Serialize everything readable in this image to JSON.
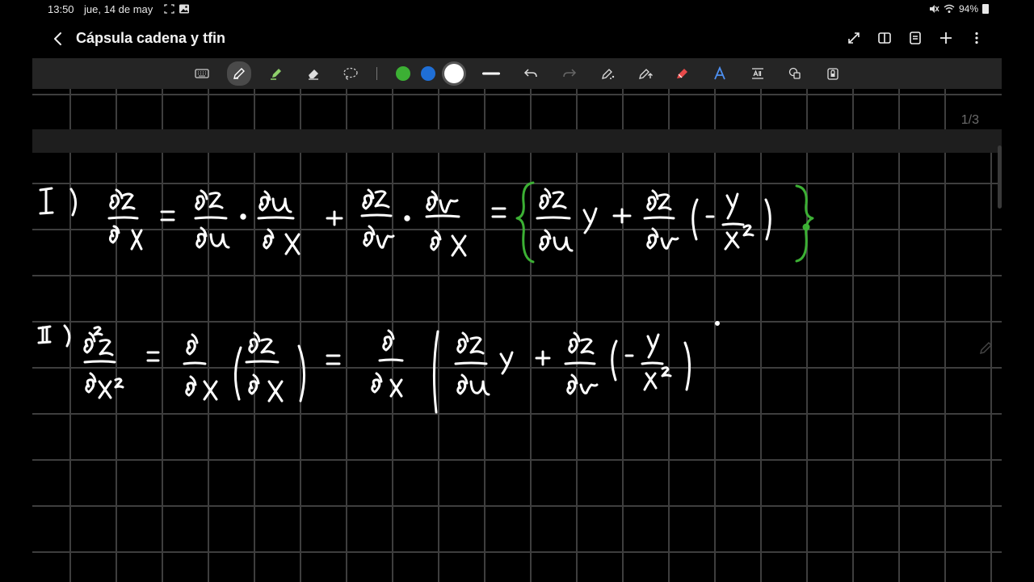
{
  "status": {
    "time": "13:50",
    "date": "jue, 14 de may",
    "battery": "94%"
  },
  "header": {
    "title": "Cápsula cadena y tfin"
  },
  "toolbar": {
    "tools": [
      "keyboard-icon",
      "pen-icon",
      "highlighter-icon",
      "eraser-icon",
      "lasso-icon"
    ],
    "colors": [
      "#3cb034",
      "#1f6fd6",
      "#ffffff"
    ],
    "actions": [
      "undo-icon",
      "redo-icon",
      "pen-settings-icon",
      "pen-up-icon",
      "marker-icon",
      "text-style-icon",
      "text-box-icon",
      "shapes-icon",
      "lock-icon"
    ]
  },
  "page": {
    "indicator": "1/3"
  },
  "colors": {
    "background": "#000000",
    "grid": "#3e3e3e",
    "ink_white": "#ffffff",
    "ink_green": "#3cb034"
  }
}
